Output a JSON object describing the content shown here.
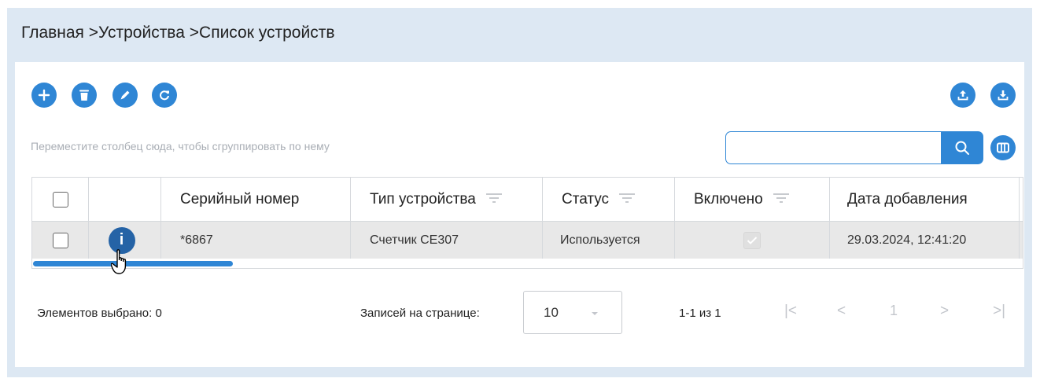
{
  "breadcrumb": {
    "items": [
      "Главная",
      "Устройства",
      "Список устройств"
    ],
    "separator": " >"
  },
  "toolbar": {
    "left_buttons": [
      "plus-icon",
      "trash-icon",
      "pencil-icon",
      "refresh-icon"
    ],
    "right_buttons": [
      "upload-icon",
      "download-icon"
    ],
    "accent": "#2f86d5"
  },
  "grouping": {
    "hint": "Переместите столбец сюда, чтобы сгруппировать по нему"
  },
  "search": {
    "value": "",
    "placeholder": ""
  },
  "table": {
    "columns": [
      "Серийный номер",
      "Тип устройства",
      "Статус",
      "Включено",
      "Дата добавления"
    ],
    "rows": [
      {
        "serial": "*6867",
        "type": "Счетчик СЕ307",
        "status": "Используется",
        "enabled": true,
        "added": "29.03.2024, 12:41:20"
      }
    ],
    "info_label": "i"
  },
  "footer": {
    "selected": "Элементов выбрано: 0",
    "per_page_label": "Записей на странице:",
    "per_page_value": "10",
    "range": "1-1 из 1",
    "page": "1",
    "first": "|<",
    "prev": "<",
    "next": ">",
    "last": ">|"
  }
}
